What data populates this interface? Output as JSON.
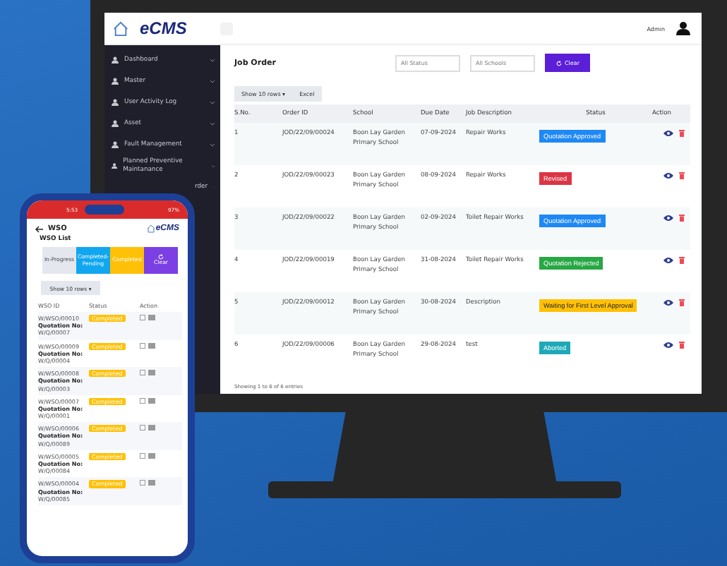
{
  "desktop": {
    "logo": "eCMS",
    "user": "Admin",
    "sidebar": [
      "Dashboard",
      "Master",
      "User Activity Log",
      "Asset",
      "Fault Management",
      "Planned Preventive Maintanance",
      "rder"
    ],
    "title": "Job Order",
    "filters": [
      {
        "placeholder": "All Status"
      },
      {
        "placeholder": "All Schools"
      }
    ],
    "clear": "Clear",
    "toolbar": [
      "Show 10 rows ▾",
      "Excel"
    ],
    "table": {
      "columns": [
        "S.No.",
        "Order ID",
        "School",
        "Due Date",
        "Job Description",
        "Status",
        "Action"
      ],
      "rows": [
        {
          "sno": "1",
          "id": "JOD/22/09/00024",
          "school": "Boon Lay Garden Primary School",
          "due": "07-09-2024",
          "desc": "Repair Works",
          "status": "Quotation Approved",
          "color": "#1e88f5"
        },
        {
          "sno": "2",
          "id": "JOD/22/09/00023",
          "school": "Boon Lay Garden Primary School",
          "due": "08-09-2024",
          "desc": "Repair Works",
          "status": "Revised",
          "color": "#dc3545"
        },
        {
          "sno": "3",
          "id": "JOD/22/09/00022",
          "school": "Boon Lay Garden Primary School",
          "due": "02-09-2024",
          "desc": "Toilet Repair Works",
          "status": "Quotation Approved",
          "color": "#1e88f5"
        },
        {
          "sno": "4",
          "id": "JOD/22/09/00019",
          "school": "Boon Lay Garden Primary School",
          "due": "31-08-2024",
          "desc": "Toilet Repair Works",
          "status": "Quotation Rejected",
          "color": "#28a745"
        },
        {
          "sno": "5",
          "id": "JOD/22/09/00012",
          "school": "Boon Lay Garden Primary School",
          "due": "30-08-2024",
          "desc": "Description",
          "status": "Waiting for First Level Approval",
          "color": "#ffc107"
        },
        {
          "sno": "6",
          "id": "JOD/22/09/00006",
          "school": "Boon Lay Garden Primary School",
          "due": "29-08-2024",
          "desc": "test",
          "status": "Aborted",
          "color": "#1fa9b8"
        }
      ]
    },
    "footer": "Showing 1 to 6 of 6 entries"
  },
  "phone": {
    "time": "5:53",
    "battery": "97%",
    "title": "WSO",
    "logo": "eCMS",
    "list_title": "WSO List",
    "tabs": [
      {
        "label": "In-Progress",
        "color": "#e4e7ee"
      },
      {
        "label": "Completed-Pending",
        "color": "#10a7f0"
      },
      {
        "label": "Completed",
        "color": "#ffc107"
      },
      {
        "label": "Clear",
        "color": "#7b3fe4"
      }
    ],
    "show": "Show 10 rows ▾",
    "columns": [
      "WSO ID",
      "Status",
      "Action"
    ],
    "rows": [
      {
        "id": "W/WSO/00010",
        "label": "Quotation No:",
        "q": "W/Q/00007",
        "status": "Completed"
      },
      {
        "id": "W/WSO/00009",
        "label": "Quotation No:",
        "q": "W/Q/00004",
        "status": "Completed"
      },
      {
        "id": "W/WSO/00008",
        "label": "Quotation No:",
        "q": "W/Q/00003",
        "status": "Completed"
      },
      {
        "id": "W/WSO/00007",
        "label": "Quotation No:",
        "q": "W/Q/00001",
        "status": "Completed"
      },
      {
        "id": "W/WSO/00006",
        "label": "Quotation No:",
        "q": "W/Q/00089",
        "status": "Completed"
      },
      {
        "id": "W/WSO/00005",
        "label": "Quotation No:",
        "q": "W/Q/00084",
        "status": "Completed"
      },
      {
        "id": "W/WSO/00004",
        "label": "Quotation No:",
        "q": "W/Q/00085",
        "status": "Completed"
      }
    ]
  }
}
